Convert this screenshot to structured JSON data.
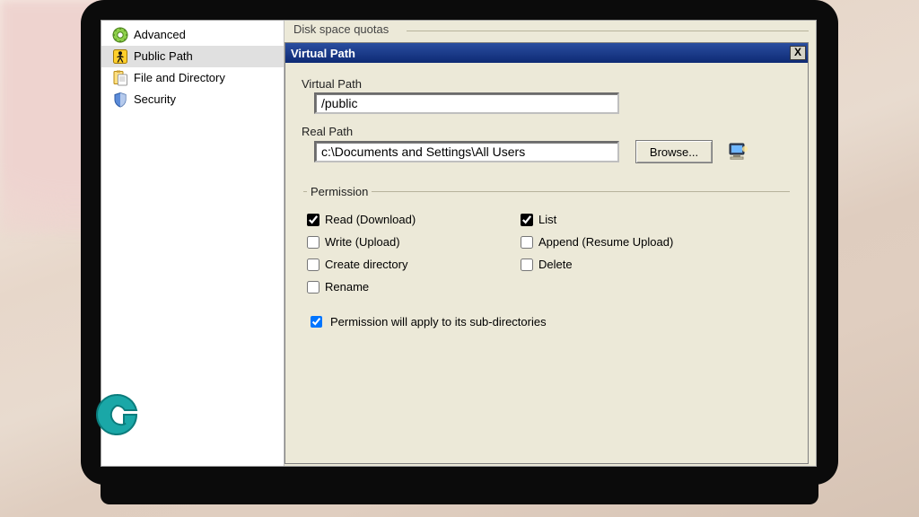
{
  "sidebar": {
    "items": [
      {
        "label": "Advanced",
        "icon": "gear-icon"
      },
      {
        "label": "Public Path",
        "icon": "sign-icon",
        "selected": true
      },
      {
        "label": "File and Directory",
        "icon": "clipboard-icon"
      },
      {
        "label": "Security",
        "icon": "shield-icon"
      }
    ]
  },
  "groupbox": {
    "label": "Disk space quotas"
  },
  "dialog": {
    "title": "Virtual Path",
    "close_label": "X",
    "virtual_path": {
      "label": "Virtual Path",
      "value": "/public"
    },
    "real_path": {
      "label": "Real Path",
      "value": "c:\\Documents and Settings\\All Users",
      "browse_label": "Browse..."
    },
    "permission": {
      "legend": "Permission",
      "options": [
        {
          "key": "read",
          "label": "Read (Download)",
          "checked": true
        },
        {
          "key": "list",
          "label": "List",
          "checked": true
        },
        {
          "key": "write",
          "label": "Write (Upload)",
          "checked": false
        },
        {
          "key": "append",
          "label": "Append (Resume Upload)",
          "checked": false
        },
        {
          "key": "mkdir",
          "label": "Create directory",
          "checked": false
        },
        {
          "key": "delete",
          "label": "Delete",
          "checked": false
        },
        {
          "key": "rename",
          "label": "Rename",
          "checked": false
        }
      ],
      "apply_sub": {
        "label": "Permission will apply to its sub-directories",
        "checked": true
      }
    }
  }
}
